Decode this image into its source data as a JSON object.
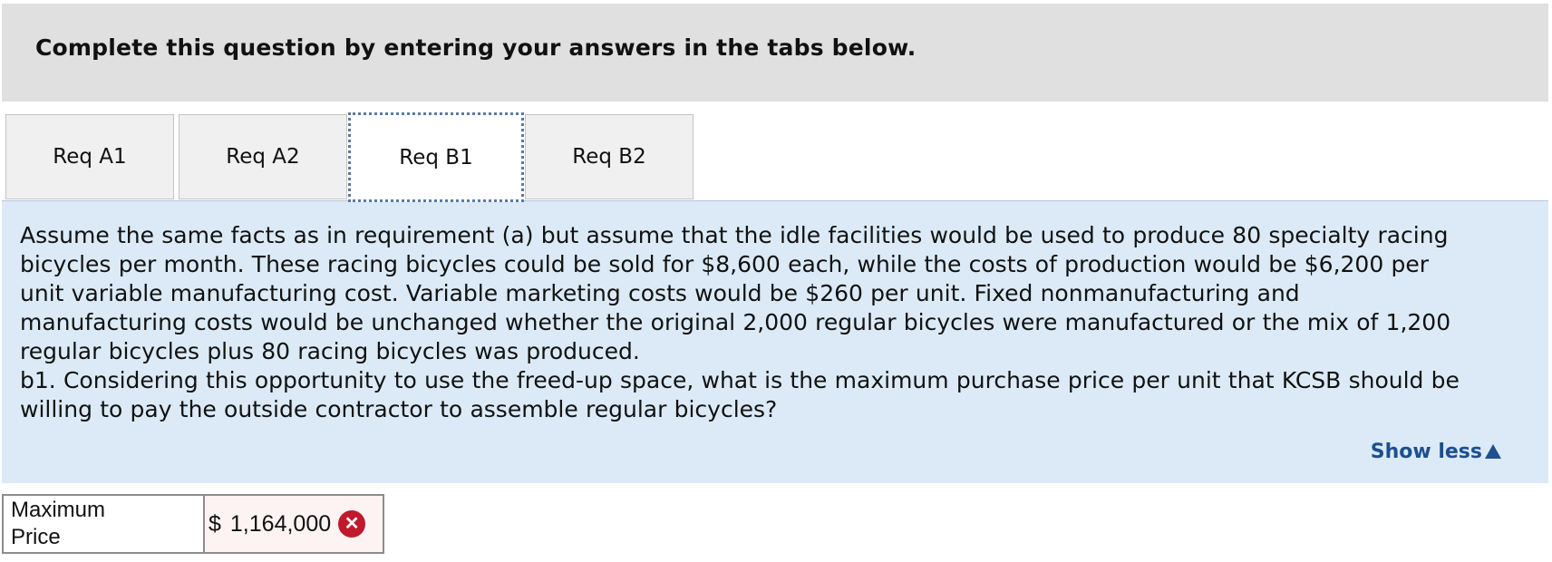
{
  "header": {
    "instruction": "Complete this question by entering your answers in the tabs below."
  },
  "tabs": [
    {
      "label": "Req A1",
      "active": false
    },
    {
      "label": "Req A2",
      "active": false
    },
    {
      "label": "Req B1",
      "active": true
    },
    {
      "label": "Req B2",
      "active": false
    }
  ],
  "question": {
    "text": "Assume the same facts as in requirement (a) but assume that the idle facilities would be used to produce 80 specialty racing\nbicycles per month. These racing bicycles could be sold for $8,600 each, while the costs of production would be $6,200 per\nunit variable manufacturing cost. Variable marketing costs would be $260 per unit. Fixed nonmanufacturing and\nmanufacturing costs would be unchanged whether the original 2,000 regular bicycles were manufactured or the mix of 1,200\nregular bicycles plus 80 racing bicycles was produced.\nb1. Considering this opportunity to use the freed-up space, what is the maximum purchase price per unit that KCSB should be\nwilling to pay the outside contractor to assemble regular bicycles?",
    "show_less_label": "Show less"
  },
  "answer": {
    "label": "Maximum\nPrice",
    "currency_symbol": "$",
    "value": "1,164,000",
    "status": "incorrect",
    "status_icon": "x-circle-icon",
    "status_color": "#c0192c"
  },
  "colors": {
    "header_bg": "#e0e0e0",
    "content_bg": "#dbeaf6",
    "link": "#1d4f91"
  }
}
